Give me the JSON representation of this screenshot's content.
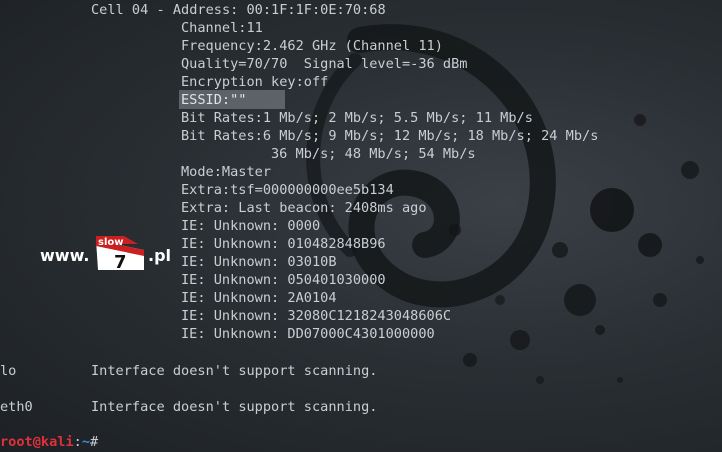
{
  "terminal": {
    "lines": [
      "Cell 04 - Address: 00:1F:1F:0E:70:68",
      "Channel:11",
      "Frequency:2.462 GHz (Channel 11)",
      "Quality=70/70  Signal level=-36 dBm",
      "Encryption key:off",
      "ESSID:\"\"",
      "Bit Rates:1 Mb/s; 2 Mb/s; 5.5 Mb/s; 11 Mb/s",
      "Bit Rates:6 Mb/s; 9 Mb/s; 12 Mb/s; 18 Mb/s; 24 Mb/s",
      "36 Mb/s; 48 Mb/s; 54 Mb/s",
      "Mode:Master",
      "Extra:tsf=000000000ee5b134",
      "Extra: Last beacon: 2408ms ago",
      "IE: Unknown: 0000",
      "IE: Unknown: 010482848B96",
      "IE: Unknown: 03010B",
      "IE: Unknown: 050401030000",
      "IE: Unknown: 2A0104",
      "IE: Unknown: 32080C1218243048606C",
      "IE: Unknown: DD07000C4301000000"
    ],
    "iface_lo": "lo",
    "iface_lo_msg": "Interface doesn't support scanning.",
    "iface_eth0": "eth0",
    "iface_eth0_msg": "Interface doesn't support scanning.",
    "prompt_user": "root@kali",
    "prompt_sep": ":",
    "prompt_path": "~",
    "prompt_symbol": "#"
  },
  "watermark": {
    "prefix": "www.",
    "brand_top": "slow",
    "brand_num": "7",
    "suffix": ".pl"
  },
  "colors": {
    "text": "#c9ced3",
    "prompt_user": "#e0303a",
    "prompt_path": "#3c8bd8",
    "background": "#2a2f34"
  }
}
